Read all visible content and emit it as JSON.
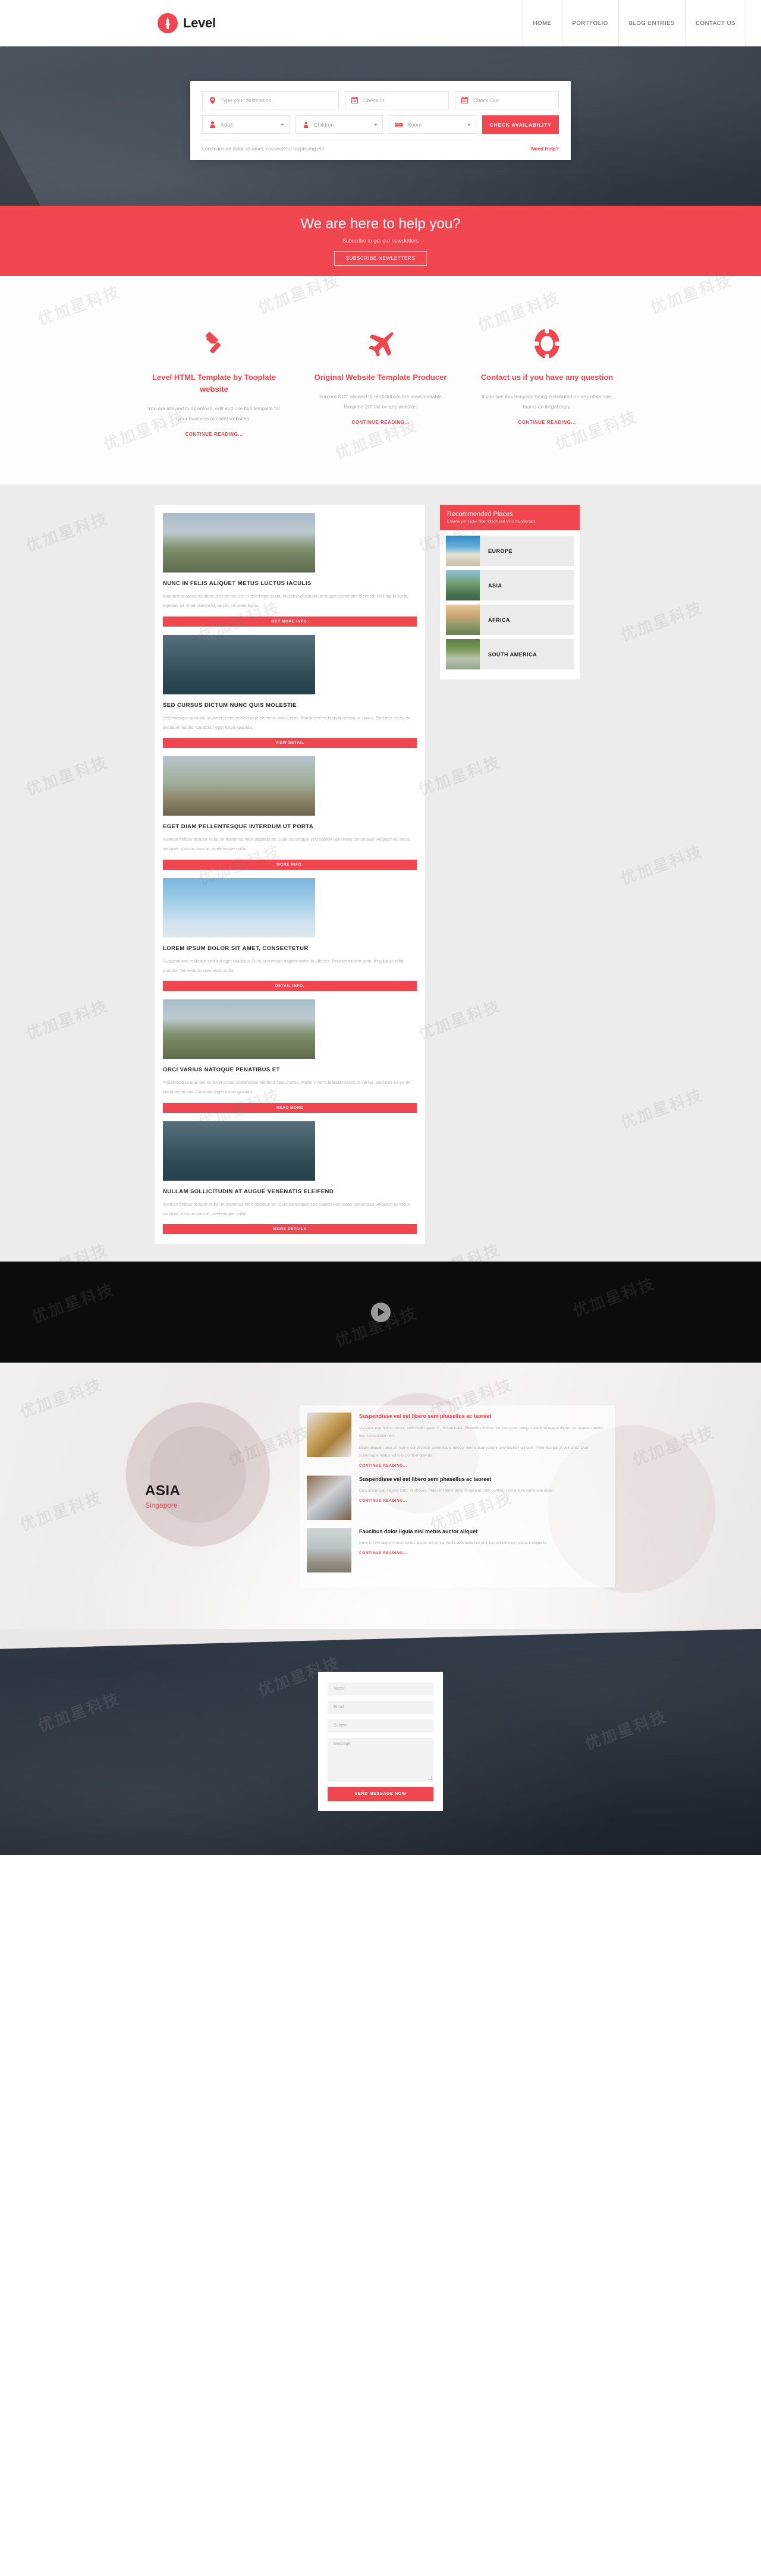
{
  "header": {
    "brand": "Level",
    "logo_icon": "pine-tree-icon",
    "nav": [
      {
        "label": "HOME",
        "active": true
      },
      {
        "label": "PORTFOLIO",
        "active": false
      },
      {
        "label": "BLOG ENTRIES",
        "active": false
      },
      {
        "label": "CONTACT US",
        "active": false
      }
    ]
  },
  "booking": {
    "destination_placeholder": "Type your destination...",
    "checkin_placeholder": "Check In",
    "checkout_placeholder": "Check Out",
    "adult_label": "Adult",
    "children_label": "Children",
    "room_label": "Room",
    "submit_label": "CHECK AVAILABILITY",
    "note": "Lorem ipsum dolor sit amet, consectetur adipiscing elit.",
    "help_link": "Need Help?",
    "icons": {
      "destination": "map-pin-icon",
      "checkin": "calendar-icon",
      "checkout": "calendar-icon",
      "adult": "person-icon",
      "children": "child-icon",
      "room": "bed-icon"
    }
  },
  "newsletter": {
    "title": "We are here to help you?",
    "subtitle": "Subscribe to get our newsletters",
    "button": "SUBSCRIBE NEWLETTERS",
    "bg_color": "#ef4650"
  },
  "features": [
    {
      "icon": "gavel-icon",
      "title": "Level HTML Template by Tooplate website",
      "desc": "You are allowed to download, edit and use this template for your business or client websites.",
      "link": "CONTINUE READING..."
    },
    {
      "icon": "airplane-icon",
      "title": "Original Website Template Producer",
      "desc": "You are NOT allowed to re-distribute the downloadable template ZIP file on any website.",
      "link": "CONTINUE READING..."
    },
    {
      "icon": "lifebuoy-icon",
      "title": "Contact us if you have any question",
      "desc": "If you see this template being distributed on any other site, that is an illegal copy.",
      "link": "CONTINUE READING..."
    }
  ],
  "posts": [
    {
      "image": "palm-tree-street-photo",
      "image_class": "img-palms",
      "title": "NUNC IN FELIS ALIQUET METUS LUCTUS IACULIS",
      "desc": "Aliquam ac lacus volutpat, dictum risus at, scelerisque nulla. Nullam sollicitudin at augue venenatis eleifend. Null ligula ligula, egestas sit amet viverra id, iaculis sit amet ligula.",
      "button": "GET MORE INFO."
    },
    {
      "image": "city-skyline-photo",
      "image_class": "img-city",
      "title": "SED CURSUS DICTUM NUNC QUIS MOLESTIE",
      "desc": "Pellentesque quis dui sit amet purus scelerisque eleifend sed ut eros. Morbi viverra blandit massa in varius. Sed nec ex eu ex tincidunt iaculis. Curabitur eget turpis gravida.",
      "button": "VIEW DETAIL"
    },
    {
      "image": "desert-road-photo",
      "image_class": "img-road",
      "title": "EGET DIAM PELLENTESQUE INTERDUM UT PORTA",
      "desc": "Aenean finibus tempor nulla, et maximus nibh dapibus ac. Duis consequat sed sapien venenatis consequat. Aliquam ac lacus volutpat, dictum risus at, scelerisque nulla.",
      "button": "MORE INFO."
    },
    {
      "image": "cloudy-sky-photo",
      "image_class": "img-sky",
      "title": "LOREM IPSUM DOLOR SIT AMET, CONSECTETUR",
      "desc": "Suspendisse molestie sed dui eget faucibus. Duis accumsan sagittis tortor in ultrices. Praesent tortor ante, fringilla ac nibh porttitor, fermentum commodo nulla.",
      "button": "DETAIL INFO."
    },
    {
      "image": "palm-tree-street-photo",
      "image_class": "img-palms",
      "title": "ORCI VARIUS NATOQUE PENATIBUS ET",
      "desc": "Pellentesque quis dui sit amet purus scelerisque eleifend sed ut eros. Morbi viverra blandit massa in varius. Sed nec ex eu ex tincidunt iaculis. Curabitur eget turpis gravida.",
      "button": "READ MORE"
    },
    {
      "image": "city-skyline-photo",
      "image_class": "img-city",
      "title": "NULLAM SOLLICITUDIN AT AUGUE VENENATIS ELEIFEND",
      "desc": "Aenean finibus tempor nulla, et maximus nibh dapibus ac. Duis consequat sed sapien venenatis consequat. Aliquam ac lacus volutpat, dictum risus at, scelerisque nulla.",
      "button": "MORE DETAILS"
    }
  ],
  "sidebar": {
    "title": "Recommended Places",
    "subtitle": "Enamel pin cliche tilde, kitsch and VHS thundercats",
    "items": [
      {
        "label": "EUROPE",
        "image": "europe-coastline-thumb",
        "image_class": "img-europe"
      },
      {
        "label": "ASIA",
        "image": "asia-karst-bay-thumb",
        "image_class": "img-asia"
      },
      {
        "label": "AFRICA",
        "image": "africa-hillside-thumb",
        "image_class": "img-africa"
      },
      {
        "label": "SOUTH AMERICA",
        "image": "south-america-waterfall-thumb",
        "image_class": "img-south"
      }
    ]
  },
  "video": {
    "icon": "play-icon",
    "bg_color": "#0c0c0c"
  },
  "asia": {
    "heading": "ASIA",
    "subheading": "Singapore",
    "news": [
      {
        "image": "gold-robot-photo",
        "image_class": "img-robot",
        "title": "Suspendisse vel est libero sem phasellus ac laoreet",
        "title_style": "accent",
        "p1": "Vivamus eget tellus ornare, sollicitudin quam id, dictum nulla. Phasellus finibus rhoncus justo, tempus eleifend neque dictum ac. Aenean metus leo, consectetur non.",
        "p2": "Etiam aliquam arcu at mauris consectetur scelerisque. Integer elementum justo in orci facilisis ultricies. Pellentesque at velit ante. Duis scelerisque metus vel felis porttitor gravida.",
        "link": "CONTINUE READING..."
      },
      {
        "image": "laptop-desk-photo",
        "image_class": "img-laptop",
        "title": "Suspendisse vel est libero sem phasellus ac laoreet",
        "title_style": "dark",
        "p1": "Duis accumsan sagittis tortor in ultrices. Praesent tortor ante, fringilla ac nibh porttitor, fermentum commodo nulla.",
        "p2": "",
        "link": "CONTINUE READING..."
      },
      {
        "image": "yoga-silhouette-photo",
        "image_class": "img-yoga",
        "title": "Faucibus dolor ligula nisl metus auctor aliquet",
        "title_style": "dark",
        "p1": "Nunc in felis aliquet metus luctus iaculis vel et nisi. Nulla venenatis nisl orci, laoreet ultricies massa tristique id.",
        "p2": "",
        "link": "CONTINUE READING..."
      }
    ]
  },
  "contact": {
    "name_placeholder": "Name",
    "email_placeholder": "Email",
    "subject_placeholder": "Subject",
    "message_placeholder": "Message",
    "submit_label": "SEND MESSAGE NOW"
  },
  "colors": {
    "accent": "#ef4650",
    "dark": "#0c0c0c",
    "muted": "#b4b4b4"
  }
}
